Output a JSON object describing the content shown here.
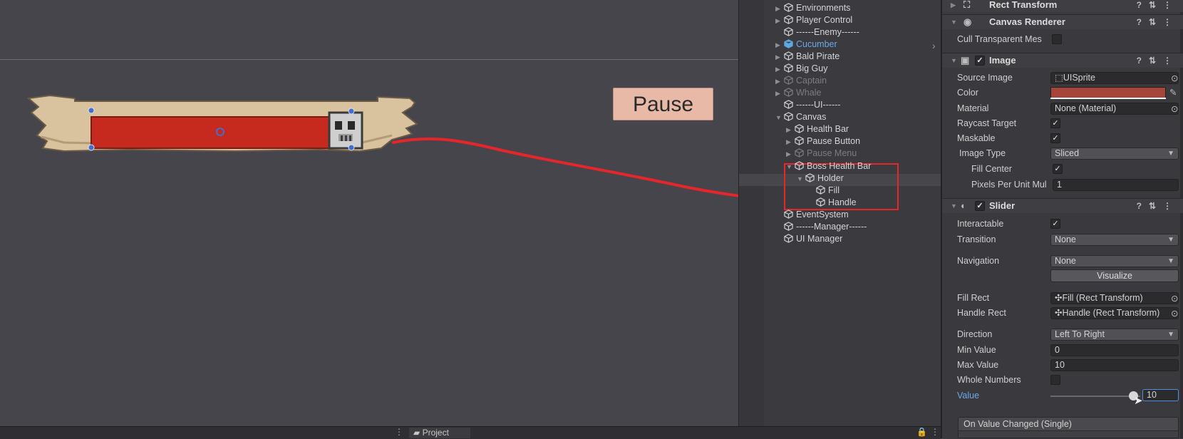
{
  "scene": {
    "pause_label": "Pause",
    "bar_fill_color": "#c62a1e",
    "scroll_color": "#d9c39f",
    "arrow_color": "#e5262a"
  },
  "bottom": {
    "project_tab": "Project"
  },
  "hierarchy": {
    "items": [
      {
        "label": "Environments",
        "state": "normal"
      },
      {
        "label": "Player Control",
        "state": "normal"
      },
      {
        "label": "------Enemy------",
        "state": "normal"
      },
      {
        "label": "Cucumber",
        "state": "blue"
      },
      {
        "label": "Bald Pirate",
        "state": "normal"
      },
      {
        "label": "Big Guy",
        "state": "normal"
      },
      {
        "label": "Captain",
        "state": "dim"
      },
      {
        "label": "Whale",
        "state": "dim"
      },
      {
        "label": "------UI------",
        "state": "normal"
      },
      {
        "label": "Canvas",
        "state": "normal"
      },
      {
        "label": "Health Bar",
        "state": "normal"
      },
      {
        "label": "Pause Button",
        "state": "normal"
      },
      {
        "label": "Pause Menu",
        "state": "dim"
      },
      {
        "label": "Boss Health Bar",
        "state": "normal"
      },
      {
        "label": "Holder",
        "state": "normal"
      },
      {
        "label": "Fill",
        "state": "normal"
      },
      {
        "label": "Handle",
        "state": "normal"
      },
      {
        "label": "EventSystem",
        "state": "normal"
      },
      {
        "label": "------Manager------",
        "state": "normal"
      },
      {
        "label": "UI Manager",
        "state": "normal"
      }
    ]
  },
  "inspector": {
    "rect_transform": "Rect Transform",
    "canvas_renderer": "Canvas Renderer",
    "cull_transparent": "Cull Transparent Mes",
    "image": {
      "title": "Image",
      "source_image_label": "Source Image",
      "source_image_value": "UISprite",
      "color_label": "Color",
      "color_value": "#a8453a",
      "material_label": "Material",
      "material_value": "None (Material)",
      "raycast_label": "Raycast Target",
      "maskable_label": "Maskable",
      "image_type_label": "Image Type",
      "image_type_value": "Sliced",
      "fill_center_label": "Fill Center",
      "ppu_label": "Pixels Per Unit Mul",
      "ppu_value": "1"
    },
    "slider": {
      "title": "Slider",
      "interactable_label": "Interactable",
      "transition_label": "Transition",
      "transition_value": "None",
      "navigation_label": "Navigation",
      "navigation_value": "None",
      "visualize_label": "Visualize",
      "fill_rect_label": "Fill Rect",
      "fill_rect_value": "Fill (Rect Transform)",
      "handle_rect_label": "Handle Rect",
      "handle_rect_value": "Handle (Rect Transform)",
      "direction_label": "Direction",
      "direction_value": "Left To Right",
      "min_label": "Min Value",
      "min_value": "0",
      "max_label": "Max Value",
      "max_value": "10",
      "whole_label": "Whole Numbers",
      "value_label": "Value",
      "value_value": "10"
    },
    "on_value_changed": "On Value Changed (Single)"
  }
}
